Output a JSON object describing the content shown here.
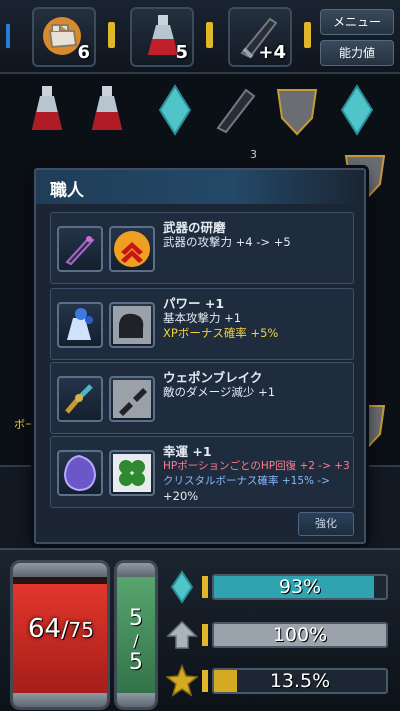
{
  "topbar": {
    "slots": [
      {
        "icon": "fist-icon",
        "count": "6"
      },
      {
        "icon": "potion-icon",
        "count": "5"
      },
      {
        "icon": "sword-icon",
        "count": "+4"
      }
    ],
    "menu_label": "メニュー",
    "stats_label": "能力値"
  },
  "background": {
    "badge_count": "3",
    "side_text": "ボー"
  },
  "modal": {
    "title": "職人",
    "cards": [
      {
        "icons": [
          "dagger-icon",
          "double-chevron-up-icon"
        ],
        "lines": [
          "武器の研磨",
          "武器の攻撃力 +4 -> +5"
        ]
      },
      {
        "icons": [
          "potion-splash-icon",
          "flexed-arm-icon"
        ],
        "lines": [
          "パワー +1",
          "基本攻撃力 +1",
          "XPボーナス確率 +5%"
        ]
      },
      {
        "icons": [
          "broken-sword-icon",
          "broken-blade-icon"
        ],
        "lines": [
          "ウェポンブレイク",
          "敵のダメージ減少 +1"
        ]
      },
      {
        "icons": [
          "gem-icon",
          "four-leaf-clover-icon"
        ],
        "lines": [
          "幸運 +1",
          "HPポーションごとのHP回復 +2 -> +3",
          "クリスタルボーナス確率 +15% ->",
          "+20%"
        ]
      }
    ],
    "upgrade_label": "強化"
  },
  "status": {
    "hp": {
      "current": "64",
      "max": "75",
      "level": 0.853
    },
    "mp": {
      "current": "5",
      "max": "5",
      "level": 1.0
    },
    "bars": [
      {
        "icon": "crystal-icon",
        "text": "93%",
        "level": 0.93,
        "color": "#2fa3b0"
      },
      {
        "icon": "arrow-up-icon",
        "text": "100%",
        "level": 1.0,
        "color": "#9aa3ab"
      },
      {
        "icon": "xp-star-icon",
        "text": "13.5%",
        "level": 0.135,
        "color": "#d4aa22"
      }
    ]
  },
  "colors": {
    "accent_yellow": "#e2b629",
    "hp_red": "#e3362c",
    "mp_green": "#5cab73",
    "crystal_teal": "#2fa3b0"
  }
}
